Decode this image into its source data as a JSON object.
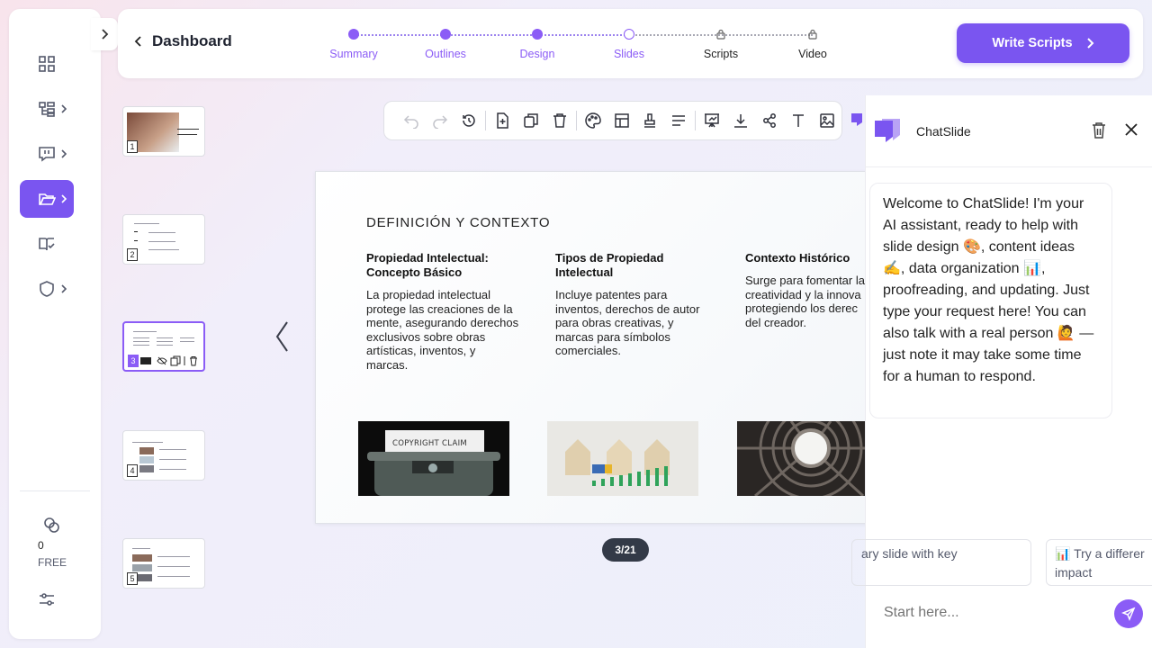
{
  "header": {
    "back_label": "Dashboard",
    "steps": [
      {
        "label": "Summary",
        "state": "done"
      },
      {
        "label": "Outlines",
        "state": "done"
      },
      {
        "label": "Design",
        "state": "done"
      },
      {
        "label": "Slides",
        "state": "current"
      },
      {
        "label": "Scripts",
        "state": "locked"
      },
      {
        "label": "Video",
        "state": "locked"
      }
    ],
    "primary_button": "Write Scripts"
  },
  "sidebar": {
    "items": [
      {
        "icon": "dashboard-grid-icon"
      },
      {
        "icon": "workflow-icon"
      },
      {
        "icon": "presentation-chat-icon"
      },
      {
        "icon": "folder-open-icon",
        "active": true
      },
      {
        "icon": "book-check-icon"
      },
      {
        "icon": "shield-icon"
      }
    ],
    "credits": "0",
    "plan": "FREE"
  },
  "thumbnails": [
    "1",
    "2",
    "3",
    "4",
    "5"
  ],
  "slide": {
    "heading": "DEFINICIÓN Y CONTEXTO",
    "columns": [
      {
        "title": "Propiedad Intelectual: Concepto Básico",
        "body": "La propiedad intelectual protege las creaciones de la mente, asegurando derechos exclusivos sobre obras artísticas, inventos, y marcas."
      },
      {
        "title": "Tipos de Propiedad Intelectual",
        "body": "Incluye patentes para inventos, derechos de autor para obras creativas, y marcas para símbolos comerciales."
      },
      {
        "title": "Contexto Histórico",
        "body": "Surge para fomentar la creatividad y la innova protegiendo los derec del creador."
      }
    ],
    "image_caption": "COPYRIGHT CLAIM",
    "page_indicator": "3/21"
  },
  "chat": {
    "title": "ChatSlide",
    "welcome": "Welcome to ChatSlide! I'm your AI assistant, ready to help with slide design 🎨, content ideas ✍️, data organization 📊, proofreading, and updating. Just type your request here! You can also talk with a real person 🙋 — just note it may take some time for a human to respond.",
    "suggestions": [
      "ary slide with key",
      "📊 Try a differer impact"
    ],
    "input_placeholder": "Start here..."
  },
  "colors": {
    "accent": "#7a55f0",
    "pill": "#333a47"
  }
}
